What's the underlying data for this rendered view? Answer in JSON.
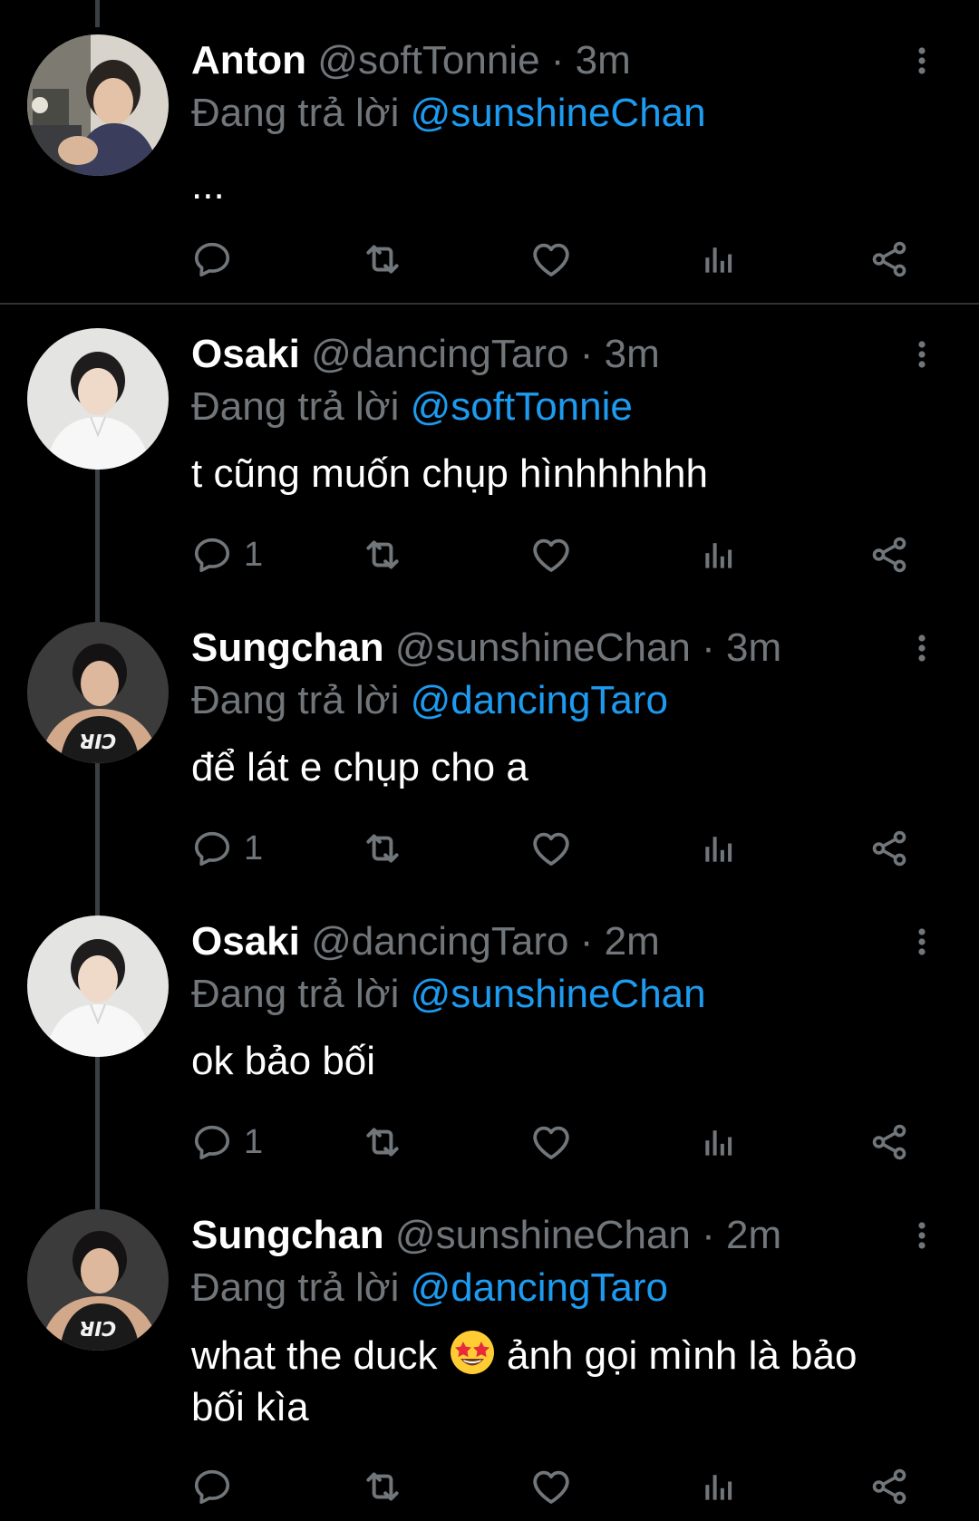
{
  "colors": {
    "background": "#000000",
    "name": "#ffffff",
    "muted": "#71767b",
    "mention": "#1d9bf0",
    "thread_line": "#3a3f44",
    "separator": "#2f3336"
  },
  "tweets": [
    {
      "name": "Anton",
      "handle": "@softTonnie",
      "dot": "·",
      "time": "3m",
      "replying_label": "Đang trả lời",
      "replying_to": "@sunshineChan",
      "text": "...",
      "reply_count": "",
      "icons": [
        "reply-icon",
        "retweet-icon",
        "like-icon",
        "analytics-icon",
        "share-icon"
      ]
    },
    {
      "name": "Osaki",
      "handle": "@dancingTaro",
      "dot": "·",
      "time": "3m",
      "replying_label": "Đang trả lời",
      "replying_to": "@softTonnie",
      "text": "t cũng muốn chụp hìnhhhhhh",
      "reply_count": "1",
      "icons": [
        "reply-icon",
        "retweet-icon",
        "like-icon",
        "analytics-icon",
        "share-icon"
      ]
    },
    {
      "name": "Sungchan",
      "handle": "@sunshineChan",
      "dot": "·",
      "time": "3m",
      "replying_label": "Đang trả lời",
      "replying_to": "@dancingTaro",
      "text": "để lát e chụp cho a",
      "reply_count": "1",
      "icons": [
        "reply-icon",
        "retweet-icon",
        "like-icon",
        "analytics-icon",
        "share-icon"
      ]
    },
    {
      "name": "Osaki",
      "handle": "@dancingTaro",
      "dot": "·",
      "time": "2m",
      "replying_label": "Đang trả lời",
      "replying_to": "@sunshineChan",
      "text": "ok bảo bối",
      "reply_count": "1",
      "icons": [
        "reply-icon",
        "retweet-icon",
        "like-icon",
        "analytics-icon",
        "share-icon"
      ]
    },
    {
      "name": "Sungchan",
      "handle": "@sunshineChan",
      "dot": "·",
      "time": "2m",
      "replying_label": "Đang trả lời",
      "replying_to": "@dancingTaro",
      "text_before_emoji": "what the duck",
      "emoji": "star-struck-emoji",
      "text_after_emoji": "ảnh gọi mình là bảo",
      "text_line2": "bối kìa",
      "reply_count": "",
      "icons": [
        "reply-icon",
        "retweet-icon",
        "like-icon",
        "analytics-icon",
        "share-icon"
      ]
    }
  ]
}
